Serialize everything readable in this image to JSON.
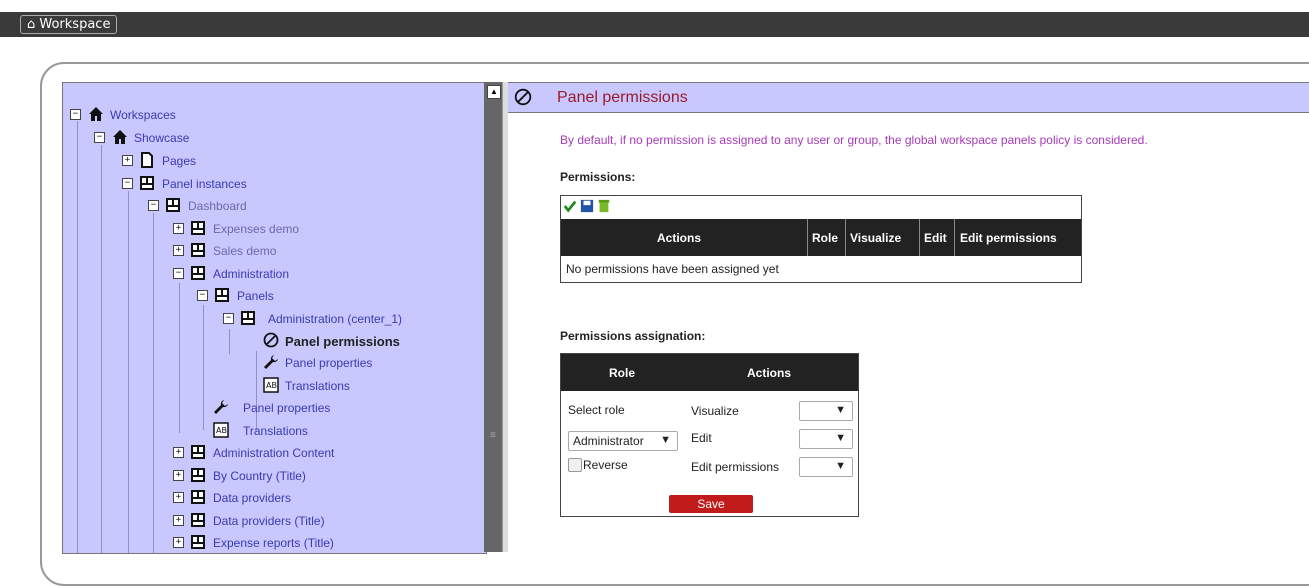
{
  "topbar": {
    "workspace_tab": "⌂ Workspace"
  },
  "tree": {
    "items": [
      {
        "label": "Workspaces"
      },
      {
        "label": "Showcase"
      },
      {
        "label": "Pages"
      },
      {
        "label": "Panel instances"
      },
      {
        "label": "Dashboard"
      },
      {
        "label": "Expenses demo"
      },
      {
        "label": "Sales demo"
      },
      {
        "label": "Administration"
      },
      {
        "label": "Panels"
      },
      {
        "label": "Administration (center_1)"
      },
      {
        "label": "Panel permissions"
      },
      {
        "label": "Panel properties"
      },
      {
        "label": "Translations"
      },
      {
        "label": "Panel properties"
      },
      {
        "label": "Translations"
      },
      {
        "label": "Administration Content"
      },
      {
        "label": "By Country (Title)"
      },
      {
        "label": "Data providers"
      },
      {
        "label": "Data providers (Title)"
      },
      {
        "label": "Expense reports (Title)"
      }
    ]
  },
  "panel": {
    "title": "Panel permissions",
    "description": "By default, if no permission is assigned to any user or group, the global workspace panels policy is considered.",
    "permissions_label": "Permissions:",
    "table_headers": [
      "Actions",
      "Role",
      "Visualize",
      "Edit",
      "Edit permissions"
    ],
    "empty_text": "No permissions have been assigned yet",
    "assignation_label": "Permissions assignation:",
    "assign_headers": [
      "Role",
      "Actions"
    ],
    "select_role_label": "Select role",
    "role_value": "Administrator",
    "reverse_label": "Reverse",
    "actions": [
      "Visualize",
      "Edit",
      "Edit permissions"
    ],
    "save_label": "Save"
  },
  "colors": {
    "tree_bg": "#c8c8ff",
    "title": "#9b1a2a",
    "description": "#a63ab8",
    "save": "#c01c1c"
  }
}
